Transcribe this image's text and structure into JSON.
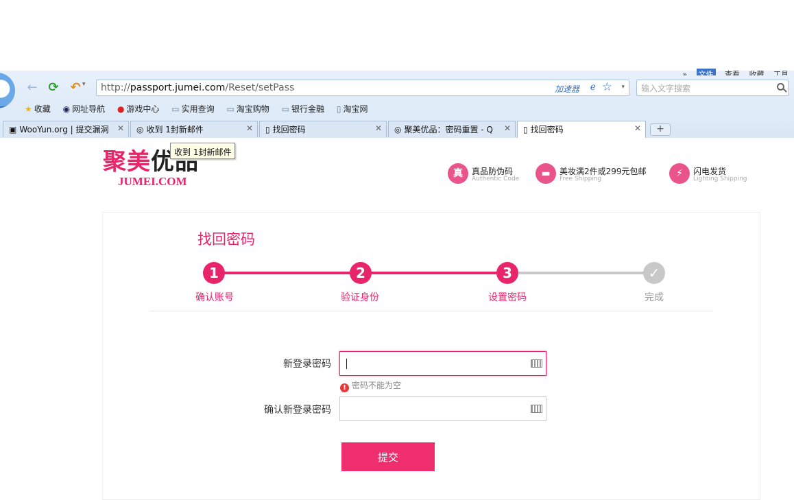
{
  "browser": {
    "top_menu": [
      "»",
      "文件",
      "查看",
      "收藏",
      "工具"
    ],
    "address": {
      "scheme": "http://",
      "host": "passport.jumei.com",
      "path": "/Reset/setPass"
    },
    "accelerator_label": "加速器",
    "search_placeholder": "输入文字搜索",
    "bookmarks": [
      {
        "label": "收藏",
        "icon": "star-icon"
      },
      {
        "label": "网址导航",
        "icon": "globe-icon"
      },
      {
        "label": "游戏中心",
        "icon": "game-icon"
      },
      {
        "label": "实用查询",
        "icon": "folder-icon"
      },
      {
        "label": "淘宝购物",
        "icon": "folder-icon"
      },
      {
        "label": "银行金融",
        "icon": "folder-icon"
      },
      {
        "label": "淘宝网",
        "icon": "page-icon"
      }
    ],
    "tabs": [
      {
        "title": "WooYun.org | 提交漏洞"
      },
      {
        "title": "收到 1封新邮件"
      },
      {
        "title": "找回密码"
      },
      {
        "title": "聚美优品：密码重置 - Q"
      },
      {
        "title": "找回密码",
        "active": true
      }
    ],
    "tooltip": "收到 1封新邮件"
  },
  "brand": {
    "cn_part1": "聚美",
    "cn_part2": "优品",
    "en": "JUMEI.COM"
  },
  "features": [
    {
      "icon_text": "真",
      "title": "真品防伪码",
      "subtitle": "Authentic Code"
    },
    {
      "icon_text": "▬",
      "title": "美妆满2件或299元包邮",
      "subtitle": "Free Shipping"
    },
    {
      "icon_text": "⚡",
      "title": "闪电发货",
      "subtitle": "Lighting Shipping"
    }
  ],
  "page_title": "找回密码",
  "steps": [
    {
      "num": "1",
      "label": "确认账号",
      "done": true
    },
    {
      "num": "2",
      "label": "验证身份",
      "done": true
    },
    {
      "num": "3",
      "label": "设置密码",
      "done": true
    },
    {
      "num": "✓",
      "label": "完成",
      "done": false
    }
  ],
  "form": {
    "new_password_label": "新登录密码",
    "confirm_password_label": "确认新登录密码",
    "error_message": "密码不能为空",
    "submit_label": "提交"
  },
  "colors": {
    "accent": "#e8246b",
    "button": "#ee2e6e",
    "inactive": "#c8c8c8"
  }
}
